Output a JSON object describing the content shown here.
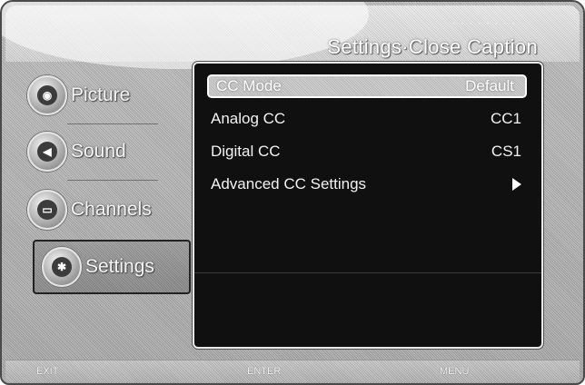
{
  "header": {
    "title": "Settings·Close Caption",
    "subtitle_ghost": "· · · · · · · ·"
  },
  "sidebar": {
    "items": [
      {
        "label": "Picture",
        "icon": "picture-icon",
        "glyph": "◉"
      },
      {
        "label": "Sound",
        "icon": "sound-icon",
        "glyph": "◀"
      },
      {
        "label": "Channels",
        "icon": "channels-icon",
        "glyph": "▭"
      },
      {
        "label": "Settings",
        "icon": "settings-icon",
        "glyph": "✱",
        "selected": true
      }
    ]
  },
  "panel": {
    "rows": [
      {
        "label": "CC Mode",
        "value": "Default",
        "highlighted": true
      },
      {
        "label": "Analog CC",
        "value": "CC1"
      },
      {
        "label": "Digital CC",
        "value": "CS1"
      },
      {
        "label": "Advanced CC Settings",
        "value": "",
        "arrow": "right-arrow-icon"
      }
    ]
  },
  "footer": {
    "hints": [
      "EXIT",
      "ENTER",
      "MENU"
    ]
  }
}
